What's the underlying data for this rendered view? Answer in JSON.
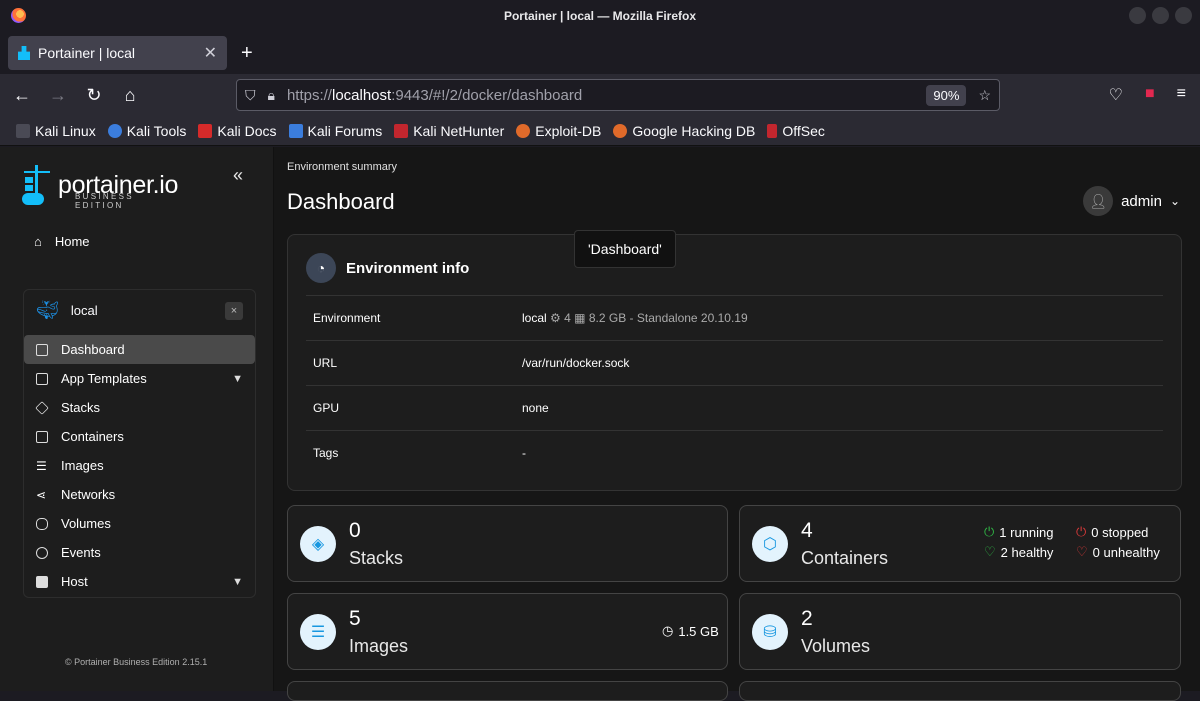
{
  "browser": {
    "window_title": "Portainer | local — Mozilla Firefox",
    "tab_title": "Portainer | local",
    "url_prefix": "https://",
    "url_host": "localhost",
    "url_rest": ":9443/#!/2/docker/dashboard",
    "zoom": "90%",
    "bookmarks": [
      "Kali Linux",
      "Kali Tools",
      "Kali Docs",
      "Kali Forums",
      "Kali NetHunter",
      "Exploit-DB",
      "Google Hacking DB",
      "OffSec"
    ],
    "extension_badge": "1"
  },
  "sidebar": {
    "logo_text": "portainer.io",
    "logo_sub": "BUSINESS EDITION",
    "home": "Home",
    "env_name": "local",
    "env_close": "×",
    "menu": [
      {
        "label": "Dashboard",
        "icon": "dashboard-icon"
      },
      {
        "label": "App Templates",
        "icon": "edit-icon"
      },
      {
        "label": "Stacks",
        "icon": "layers-icon"
      },
      {
        "label": "Containers",
        "icon": "box-icon"
      },
      {
        "label": "Images",
        "icon": "list-icon"
      },
      {
        "label": "Networks",
        "icon": "share-icon"
      },
      {
        "label": "Volumes",
        "icon": "database-icon"
      },
      {
        "label": "Events",
        "icon": "clock-icon"
      },
      {
        "label": "Host",
        "icon": "host-icon"
      }
    ],
    "footer": "© Portainer Business Edition 2.15.1"
  },
  "main": {
    "breadcrumb": "Environment summary",
    "title": "Dashboard",
    "user": "admin",
    "tooltip": "'Dashboard'",
    "env_info": {
      "title": "Environment info",
      "rows": [
        {
          "key": "Environment",
          "value": "local",
          "extra": "4",
          "extra2": "8.2 GB - Standalone 20.10.19"
        },
        {
          "key": "URL",
          "value": "/var/run/docker.sock"
        },
        {
          "key": "GPU",
          "value": "none"
        },
        {
          "key": "Tags",
          "value": "-"
        }
      ]
    },
    "cards": {
      "stacks": {
        "count": "0",
        "label": "Stacks"
      },
      "containers": {
        "count": "4",
        "label": "Containers",
        "running": "1 running",
        "stopped": "0 stopped",
        "healthy": "2 healthy",
        "unhealthy": "0 unhealthy"
      },
      "images": {
        "count": "5",
        "label": "Images",
        "size": "1.5 GB"
      },
      "volumes": {
        "count": "2",
        "label": "Volumes"
      }
    }
  }
}
